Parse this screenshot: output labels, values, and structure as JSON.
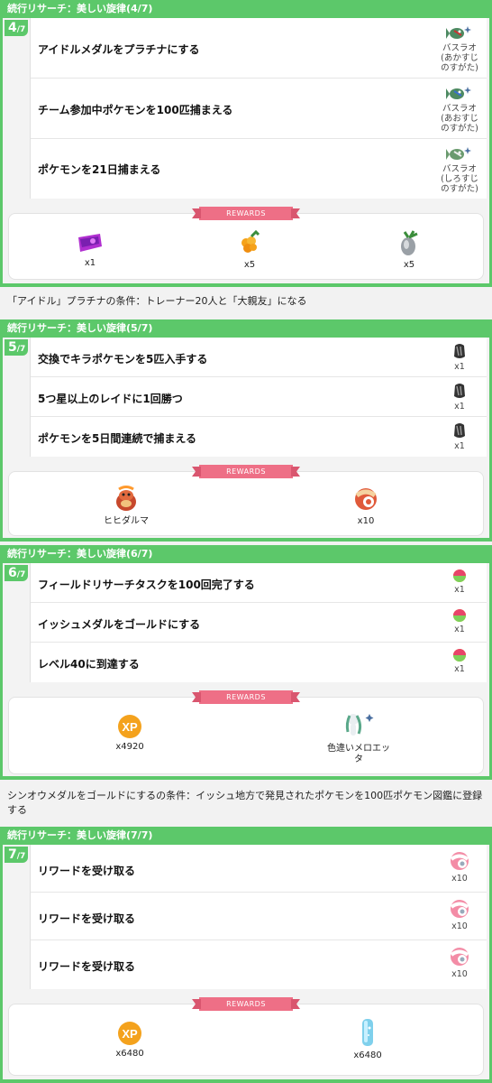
{
  "sections": [
    {
      "title": "続行リサーチ：美しい旋律(4/7)",
      "step": "4",
      "total": "7",
      "tasks": [
        {
          "label": "アイドルメダルをプラチナにする",
          "reward": "バスラオ (あかすじ のすがた)",
          "icon": "basculin-red-icon"
        },
        {
          "label": "チーム参加中ポケモンを100匹捕まえる",
          "reward": "バスラオ (あおすじ のすがた)",
          "icon": "basculin-blue-icon"
        },
        {
          "label": "ポケモンを21日捕まえる",
          "reward": "バスラオ (しろすじ のすがた)",
          "icon": "basculin-white-icon"
        }
      ],
      "rewards_label": "REWARDS",
      "rewards": [
        {
          "label": "x1",
          "icon": "lure-module-icon"
        },
        {
          "label": "x5",
          "icon": "golden-razz-berry-icon"
        },
        {
          "label": "x5",
          "icon": "silver-pinap-berry-icon"
        }
      ]
    },
    {
      "title": "続行リサーチ：美しい旋律(5/7)",
      "step": "5",
      "total": "7",
      "tasks": [
        {
          "label": "交換でキラポケモンを5匹入手する",
          "reward": "x1",
          "icon": "shell-bell-icon"
        },
        {
          "label": "5つ星以上のレイドに1回勝つ",
          "reward": "x1",
          "icon": "shell-bell-icon"
        },
        {
          "label": "ポケモンを5日間連続で捕まえる",
          "reward": "x1",
          "icon": "shell-bell-icon"
        }
      ],
      "rewards_label": "REWARDS",
      "rewards": [
        {
          "label": "ヒヒダルマ",
          "icon": "darmanitan-icon"
        },
        {
          "label": "x10",
          "icon": "darmanitan-candy-icon"
        }
      ]
    },
    {
      "title": "続行リサーチ：美しい旋律(6/7)",
      "step": "6",
      "total": "7",
      "tasks": [
        {
          "label": "フィールドリサーチタスクを100回完了する",
          "reward": "x1",
          "icon": "rainbow-gem-icon"
        },
        {
          "label": "イッシュメダルをゴールドにする",
          "reward": "x1",
          "icon": "rainbow-gem-icon"
        },
        {
          "label": "レベル40に到達する",
          "reward": "x1",
          "icon": "rainbow-gem-icon"
        }
      ],
      "rewards_label": "REWARDS",
      "rewards": [
        {
          "label": "x4920",
          "icon": "xp-icon"
        },
        {
          "label": "色違いメロエッタ",
          "icon": "shiny-meloetta-icon"
        }
      ]
    },
    {
      "title": "続行リサーチ：美しい旋律(7/7)",
      "step": "7",
      "total": "7",
      "tasks": [
        {
          "label": "リワードを受け取る",
          "reward": "x10",
          "icon": "meloetta-candy-icon"
        },
        {
          "label": "リワードを受け取る",
          "reward": "x10",
          "icon": "meloetta-candy-icon"
        },
        {
          "label": "リワードを受け取る",
          "reward": "x10",
          "icon": "meloetta-candy-icon"
        }
      ],
      "rewards_label": "REWARDS",
      "rewards": [
        {
          "label": "x6480",
          "icon": "xp-icon"
        },
        {
          "label": "x6480",
          "icon": "stardust-icon"
        }
      ]
    }
  ],
  "notes": [
    "「アイドル」プラチナの条件：トレーナー20人と「大親友」になる",
    "シンオウメダルをゴールドにするの条件：イッシュ地方で発見されたポケモンを100匹ポケモン図鑑に登録する"
  ],
  "colors": {
    "green": "#5cc86a",
    "ribbon": "#ee6f86",
    "xp": "#f4a21d"
  }
}
